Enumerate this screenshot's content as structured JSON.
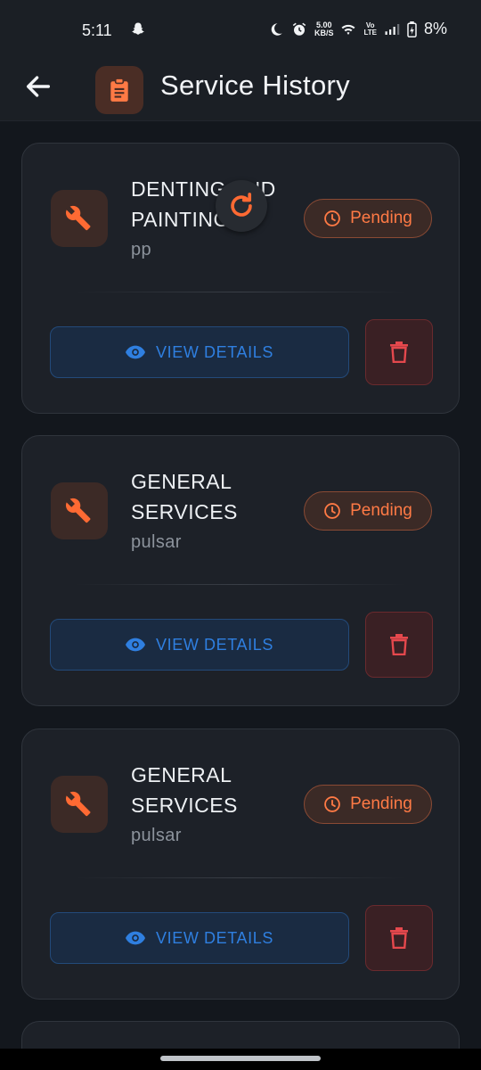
{
  "status_bar": {
    "time": "5:11",
    "net_speed_value": "5.00",
    "net_speed_unit": "KB/S",
    "volte_line1": "Vo",
    "volte_line2": "LTE",
    "battery": "8%"
  },
  "app_bar": {
    "title": "Service History",
    "title_icon": "clipboard-icon",
    "back_icon": "arrow-back-icon"
  },
  "colors": {
    "accent_orange": "#ff7a45",
    "accent_blue": "#2f7fe0",
    "danger_red": "#e5484d"
  },
  "services": [
    {
      "name": "DENTING AND PAINTING",
      "name_line1": "DENTING AND",
      "name_line2": "PAINTING",
      "vehicle": "pp",
      "status": "Pending",
      "action_label": "VIEW DETAILS"
    },
    {
      "name": "GENERAL SERVICES",
      "name_line1": "GENERAL",
      "name_line2": "SERVICES",
      "vehicle": "pulsar",
      "status": "Pending",
      "action_label": "VIEW DETAILS"
    },
    {
      "name": "GENERAL SERVICES",
      "name_line1": "GENERAL",
      "name_line2": "SERVICES",
      "vehicle": "pulsar",
      "status": "Pending",
      "action_label": "VIEW DETAILS"
    }
  ]
}
